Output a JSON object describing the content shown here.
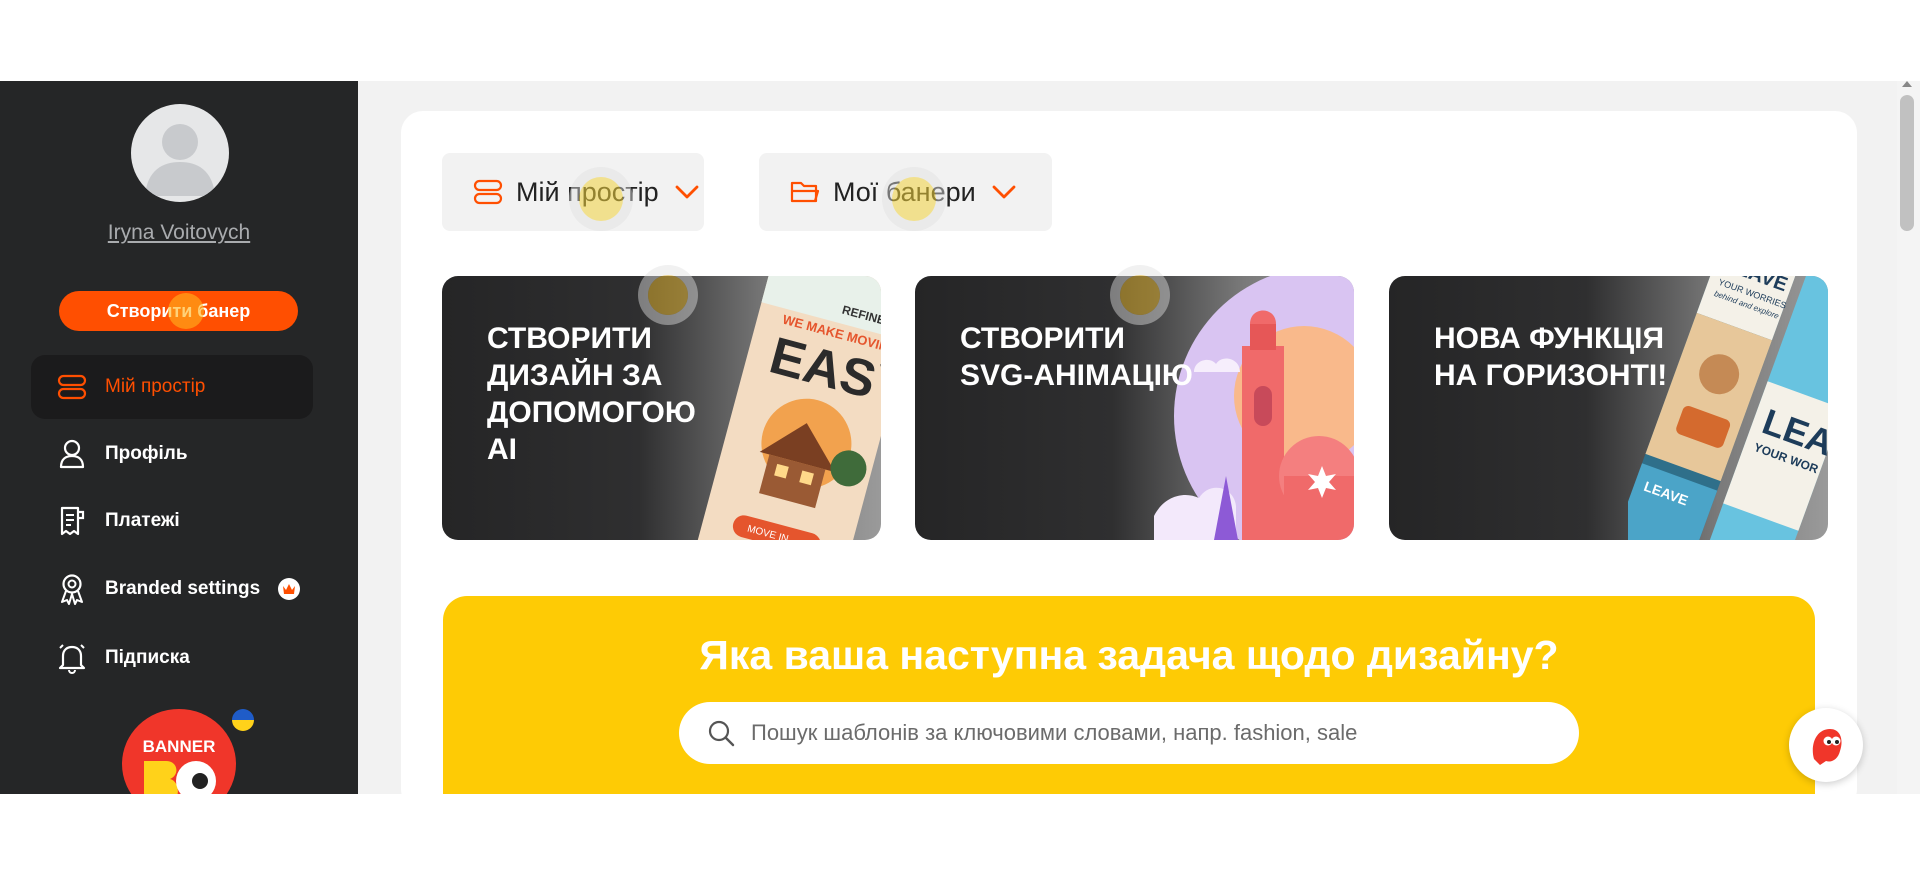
{
  "user": {
    "name": "Iryna Voitovych"
  },
  "sidebar": {
    "create_button": "Створити банер",
    "items": [
      {
        "label": "Мій простір",
        "icon": "layers-icon",
        "active": true
      },
      {
        "label": "Профіль",
        "icon": "user-icon"
      },
      {
        "label": "Платежі",
        "icon": "receipt-icon"
      },
      {
        "label": "Branded settings",
        "icon": "award-icon",
        "badge": "crown-icon"
      },
      {
        "label": "Підписка",
        "icon": "bell-icon"
      }
    ],
    "logo_text": "BANNER"
  },
  "toolbar": {
    "workspace_label": "Мій простір",
    "folder_label": "Мої банери"
  },
  "promos": [
    {
      "title": "СТВОРИТИ ДИЗАЙН ЗА ДОПОМОГОЮ AI",
      "art": {
        "brand": "REFINER",
        "headline": "WE MAKE MOVING",
        "big": "EASY",
        "cta": "MOVE IN"
      }
    },
    {
      "title": "СТВОРИТИ SVG-АНІМАЦІЮ"
    },
    {
      "title": "НОВА ФУНКЦІЯ НА ГОРИЗОНТІ!",
      "art": {
        "line1": "LEAVE",
        "line2": "YOUR WORRIES",
        "line3": "behind and explore",
        "big": "LEA",
        "sub": "YOUR WOR",
        "small": "LEAVE"
      }
    }
  ],
  "search_section": {
    "title": "Яка ваша наступна задача щодо дизайну?",
    "placeholder": "Пошук шаблонів за ключовими словами, напр. fashion, sale"
  },
  "colors": {
    "accent": "#ff4f01",
    "sidebar_bg": "#252627",
    "yellow": "#fecb05"
  }
}
